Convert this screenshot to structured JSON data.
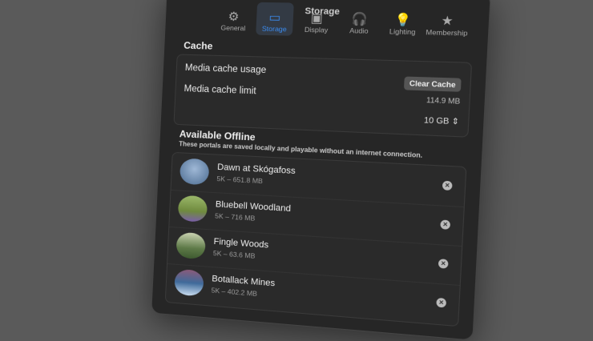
{
  "window": {
    "title": "Storage"
  },
  "tabs": [
    {
      "label": "General",
      "icon": "gear-icon",
      "glyph": "⚙"
    },
    {
      "label": "Storage",
      "icon": "drive-icon",
      "glyph": "▭",
      "active": true
    },
    {
      "label": "Display",
      "icon": "display-icon",
      "glyph": "▣"
    },
    {
      "label": "Audio",
      "icon": "headphones-icon",
      "glyph": "🎧"
    },
    {
      "label": "Lighting",
      "icon": "lightbulb-icon",
      "glyph": "💡"
    },
    {
      "label": "Membership",
      "icon": "star-icon",
      "glyph": "★"
    }
  ],
  "cache": {
    "heading": "Cache",
    "usage_label": "Media cache usage",
    "clear_button": "Clear Cache",
    "usage_value": "114.9 MB",
    "limit_label": "Media cache limit",
    "limit_value": "10 GB",
    "stepper_glyph": "⇕"
  },
  "offline": {
    "heading": "Available Offline",
    "description": "These portals are saved locally and playable without an internet connection.",
    "items": [
      {
        "name": "Dawn at Skógafoss",
        "meta": "5K – 651.8 MB",
        "color": "#5f7fa8"
      },
      {
        "name": "Bluebell Woodland",
        "meta": "5K – 716 MB",
        "color": "#6b8a4a"
      },
      {
        "name": "Fingle Woods",
        "meta": "5K – 63.6 MB",
        "color": "#5a7a4a"
      },
      {
        "name": "Botallack Mines",
        "meta": "5K – 402.2 MB",
        "color": "#3f6a9a"
      }
    ],
    "remove_glyph": "×"
  }
}
